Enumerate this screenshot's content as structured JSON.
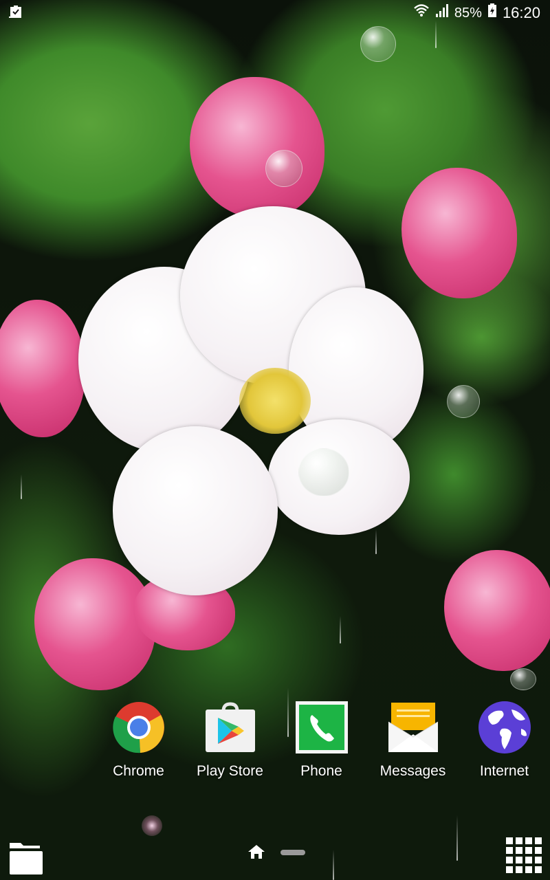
{
  "status_bar": {
    "notification_icon": "clipboard-check-icon",
    "wifi_icon": "wifi-icon",
    "signal_icon": "signal-icon",
    "battery_percent": "85%",
    "battery_icon": "battery-charging-icon",
    "time": "16:20"
  },
  "wallpaper": {
    "description": "Apple blossom with water drops and green leaves"
  },
  "dock": {
    "apps": [
      {
        "label": "Chrome",
        "icon": "chrome-icon"
      },
      {
        "label": "Play Store",
        "icon": "play-store-icon"
      },
      {
        "label": "Phone",
        "icon": "phone-icon"
      },
      {
        "label": "Messages",
        "icon": "messages-icon"
      },
      {
        "label": "Internet",
        "icon": "internet-globe-icon"
      }
    ]
  },
  "bottom_bar": {
    "left_icon": "folder-icon",
    "home_icon": "home-icon",
    "page_indicator": "page-indicator",
    "right_icon": "app-drawer-grid-icon"
  },
  "colors": {
    "phone_green": "#1db445",
    "messages_yellow": "#f7b500",
    "globe_purple": "#5b3fd6"
  }
}
